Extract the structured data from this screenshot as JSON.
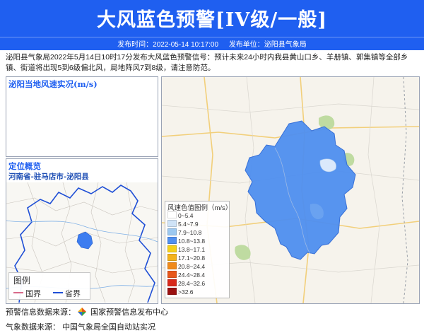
{
  "header": {
    "title": "大风蓝色预警[IV级/一般]",
    "publish_time_label": "发布时间：2022-05-14 10:17:00",
    "publish_unit_label": "发布单位：泌阳县气象局"
  },
  "description": "泌阳县气象局2022年5月14日10时17分发布大风蓝色预警信号：预计未来24小时内我县黄山口乡、羊册镇、郭集镇等全部乡镇、街道将出现5到6级偏北风，局地阵风7到8级，请注意防范。",
  "wind_panel": {
    "title": "泌阳当地风速实况(m/s)"
  },
  "location_panel": {
    "title": "定位概览",
    "subtitle": "河南省-驻马店市-泌阳县",
    "legend_title": "图例",
    "legend_items": [
      {
        "label": "国界",
        "color": "#d86a8a"
      },
      {
        "label": "省界",
        "color": "#1f4fd6"
      }
    ]
  },
  "map_legend": {
    "title": "风速色值图例（m/s）",
    "items": [
      {
        "label": "0~5.4",
        "color": "#ffffff"
      },
      {
        "label": "5.4~7.9",
        "color": "#cfe3f7"
      },
      {
        "label": "7.9~10.8",
        "color": "#9cc8f0"
      },
      {
        "label": "10.8~13.8",
        "color": "#4f8ff0"
      },
      {
        "label": "13.8~17.1",
        "color": "#f5d11a"
      },
      {
        "label": "17.1~20.8",
        "color": "#f3b21a"
      },
      {
        "label": "20.8~24.4",
        "color": "#f08a1a"
      },
      {
        "label": "24.4~28.4",
        "color": "#e8561a"
      },
      {
        "label": "28.4~32.6",
        "color": "#d8281a"
      },
      {
        "label": ">32.6",
        "color": "#9a1010"
      }
    ]
  },
  "colors": {
    "header_blue": "#1f5ff0",
    "region_fill": "#4f8ff0",
    "panel_title": "#1f5ff0"
  },
  "footer": {
    "warning_source_label": "预警信息数据来源：",
    "warning_source_value": "国家预警信息发布中心",
    "weather_source_label": "气象数据来源：",
    "weather_source_value": "中国气象局全国自动站实况"
  }
}
